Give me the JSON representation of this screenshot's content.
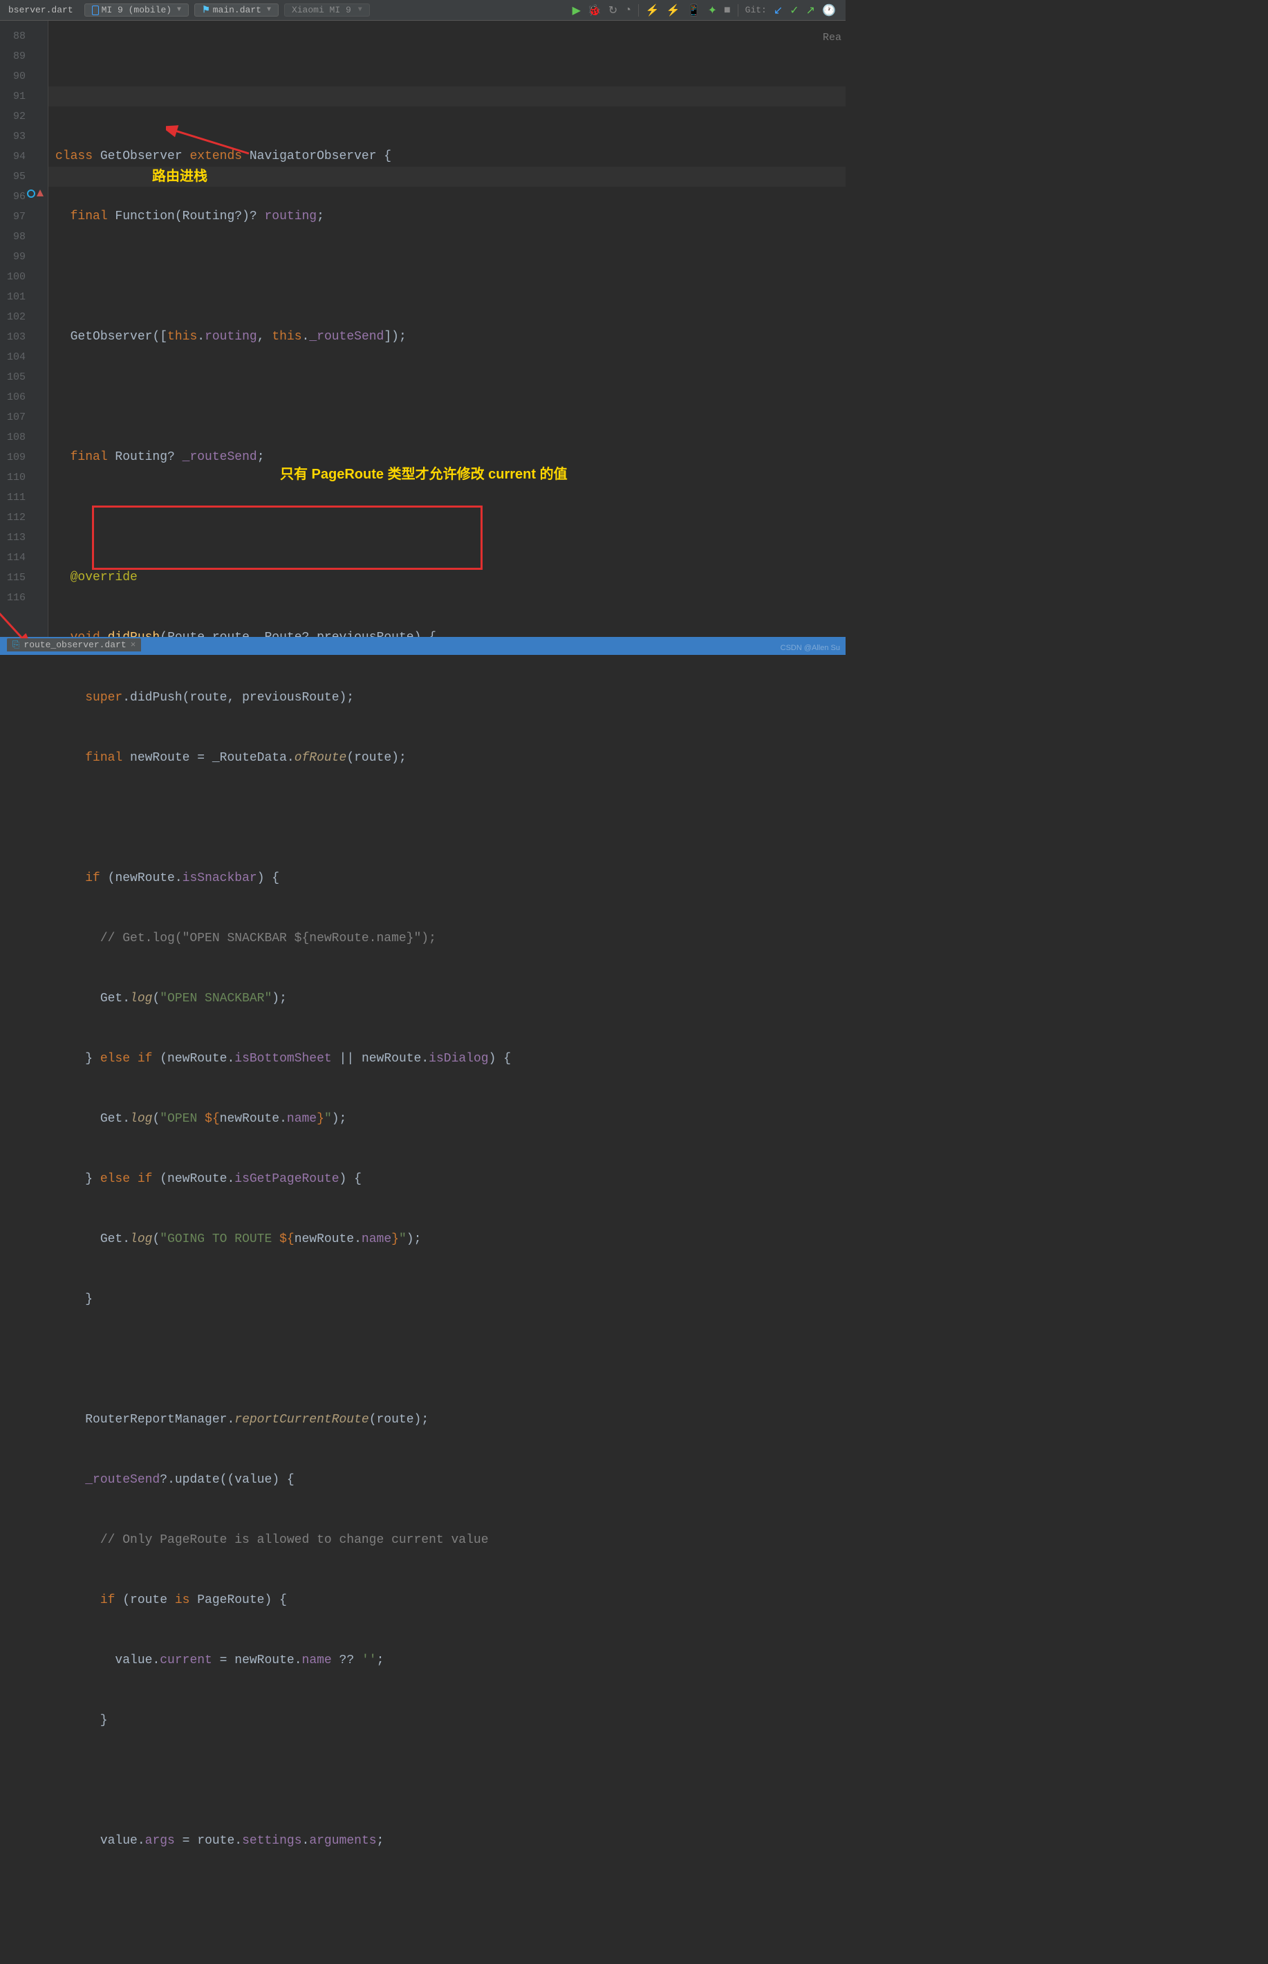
{
  "toolbar": {
    "breadcrumb_file": "bserver.dart",
    "device_label": "MI 9 (mobile)",
    "run_config": "main.dart",
    "target_device": "Xiaomi MI 9",
    "git_label": "Git:"
  },
  "right_indicator": "Rea",
  "gutter_lines": [
    "88",
    "89",
    "90",
    "91",
    "92",
    "93",
    "94",
    "95",
    "96",
    "97",
    "98",
    "99",
    "100",
    "101",
    "102",
    "103",
    "104",
    "105",
    "106",
    "107",
    "108",
    "109",
    "110",
    "111",
    "112",
    "113",
    "114",
    "115",
    "116"
  ],
  "annotations": {
    "push_label": "路由进栈",
    "pageroute_label": "只有 PageRoute 类型才允许修改 current 的值"
  },
  "code": {
    "l88": {
      "kw1": "class ",
      "cls": "GetObserver",
      "kw2": " extends ",
      "sup": "NavigatorObserver",
      "end": " {"
    },
    "l89": {
      "indent": "  ",
      "kw": "final ",
      "type": "Function",
      "paren_open": "(",
      "ptype": "Routing",
      "q": "?)? ",
      "name": "routing",
      "semi": ";"
    },
    "l91": {
      "indent": "  ",
      "ctor": "GetObserver",
      "args_open": "([",
      "this1": "this",
      "dot1": ".",
      "f1": "routing",
      "comma": ", ",
      "this2": "this",
      "dot2": ".",
      "f2": "_routeSend",
      "args_close": "]);"
    },
    "l93": {
      "indent": "  ",
      "kw": "final ",
      "type": "Routing",
      "q": "? ",
      "name": "_routeSend",
      "semi": ";"
    },
    "l95": {
      "indent": "  ",
      "anno": "@override"
    },
    "l96": {
      "indent": "  ",
      "kw": "void ",
      "fn": "didPush",
      "open": "(",
      "t1": "Route ",
      "p1": "route",
      "comma": ", ",
      "t2": "Route",
      "q": "? ",
      "p2": "previousRoute",
      "close": ") {"
    },
    "l97": {
      "indent": "    ",
      "kw": "super",
      "dot": ".",
      "call": "didPush",
      "args": "(route, previousRoute);"
    },
    "l98": {
      "indent": "    ",
      "kw": "final ",
      "var": "newRoute",
      "eq": " = ",
      "cls": "_RouteData",
      "dot": ".",
      "m": "ofRoute",
      "args": "(route);"
    },
    "l100": {
      "indent": "    ",
      "kw": "if ",
      "open": "(",
      "obj": "newRoute",
      "dot": ".",
      "prop": "isSnackbar",
      "close": ") {"
    },
    "l101": {
      "indent": "      ",
      "cmt": "// Get.log(\"OPEN SNACKBAR ${newRoute.name}\");"
    },
    "l102": {
      "indent": "      ",
      "obj": "Get",
      "dot": ".",
      "call": "log",
      "open": "(",
      "str": "\"OPEN SNACKBAR\"",
      "close": ");"
    },
    "l103": {
      "indent": "    } ",
      "kw": "else if ",
      "open": "(",
      "obj1": "newRoute",
      "dot1": ".",
      "p1": "isBottomSheet",
      "or": " || ",
      "obj2": "newRoute",
      "dot2": ".",
      "p2": "isDialog",
      "close": ") {"
    },
    "l104": {
      "indent": "      ",
      "obj": "Get",
      "dot": ".",
      "call": "log",
      "open": "(",
      "str1": "\"OPEN ",
      "interp_open": "${",
      "iobj": "newRoute",
      "idot": ".",
      "iprop": "name",
      "interp_close": "}",
      "str2": "\"",
      "close": ");"
    },
    "l105": {
      "indent": "    } ",
      "kw": "else if ",
      "open": "(",
      "obj": "newRoute",
      "dot": ".",
      "prop": "isGetPageRoute",
      "close": ") {"
    },
    "l106": {
      "indent": "      ",
      "obj": "Get",
      "dot": ".",
      "call": "log",
      "open": "(",
      "str1": "\"GOING TO ROUTE ",
      "interp_open": "${",
      "iobj": "newRoute",
      "idot": ".",
      "iprop": "name",
      "interp_close": "}",
      "str2": "\"",
      "close": ");"
    },
    "l107": {
      "indent": "    }",
      "close": ""
    },
    "l109": {
      "indent": "    ",
      "cls": "RouterReportManager",
      "dot": ".",
      "m": "reportCurrentRoute",
      "args": "(route);"
    },
    "l110": {
      "indent": "    ",
      "obj": "_routeSend",
      "q": "?",
      "dot": ".",
      "call": "update",
      "open": "((",
      "param": "value",
      "close": ") {"
    },
    "l111": {
      "indent": "      ",
      "cmt": "// Only PageRoute is allowed to change current value"
    },
    "l112": {
      "indent": "      ",
      "kw": "if ",
      "open": "(",
      "obj": "route ",
      "is": "is ",
      "type": "PageRoute",
      "close": ") {"
    },
    "l113": {
      "indent": "        ",
      "obj": "value",
      "dot": ".",
      "prop": "current",
      "eq": " = ",
      "obj2": "newRoute",
      "dot2": ".",
      "prop2": "name",
      "null": " ?? ",
      "str": "''",
      "semi": ";"
    },
    "l114": {
      "indent": "      }"
    },
    "l116": {
      "indent": "      ",
      "obj": "value",
      "dot": ".",
      "prop": "args",
      "eq": " = ",
      "obj2": "route",
      "dot2": ".",
      "prop2": "settings",
      "dot3": ".",
      "prop3": "arguments",
      "semi": ";"
    }
  },
  "bottom_tab": {
    "filename": "route_observer.dart"
  },
  "watermark": "CSDN @Allen Su"
}
